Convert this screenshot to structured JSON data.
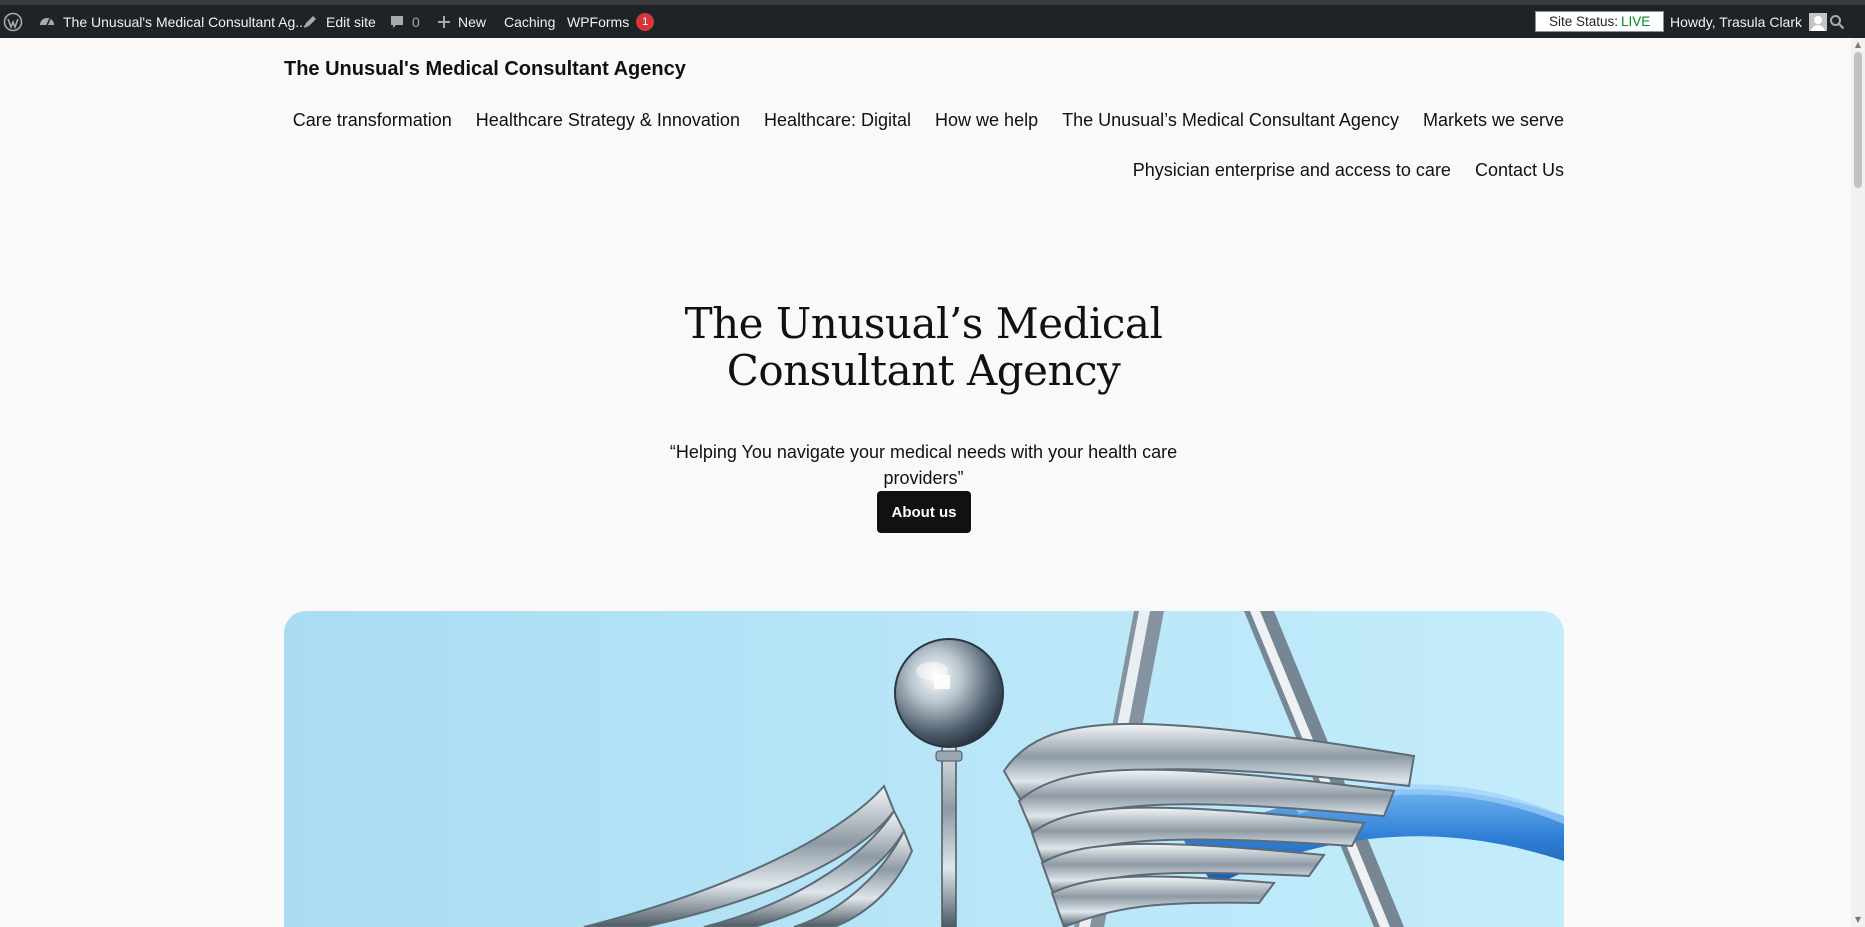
{
  "admin_bar": {
    "site_name": "The Unusual's Medical Consultant Ag...",
    "edit_site": "Edit site",
    "comments_count": "0",
    "new_label": "New",
    "caching_label": "Caching",
    "wpforms_label": "WPForms",
    "wpforms_badge": "1",
    "site_status_label": "Site Status:",
    "site_status_value": "LIVE",
    "greeting": "Howdy, Trasula Clark",
    "icons": [
      "wordpress-logo-icon",
      "dashboard-icon",
      "pencil-icon",
      "comment-icon",
      "plus-icon",
      "search-icon"
    ]
  },
  "header": {
    "site_title": "The Unusual's Medical Consultant Agency",
    "nav": [
      "Care transformation",
      "Healthcare Strategy & Innovation",
      "Healthcare: Digital",
      "How we help",
      "The Unusual’s Medical Consultant Agency",
      "Markets we serve",
      "Physician enterprise and access to care",
      "Contact Us"
    ]
  },
  "hero": {
    "title": "The Unusual’s Medical Consultant Agency",
    "subtitle": "“Helping You navigate your medical needs with your health care providers”",
    "button": "About us"
  },
  "image": {
    "description_icon": "caduceus-stethoscope-image"
  },
  "colors": {
    "admin_bar_bg": "#1d2327",
    "page_bg": "#f9f9f9",
    "button_bg": "#111111",
    "live_green": "#008a20",
    "badge_red": "#d63638",
    "image_sky": "#b6e6f7",
    "stethoscope_blue": "#2f7fd6"
  }
}
